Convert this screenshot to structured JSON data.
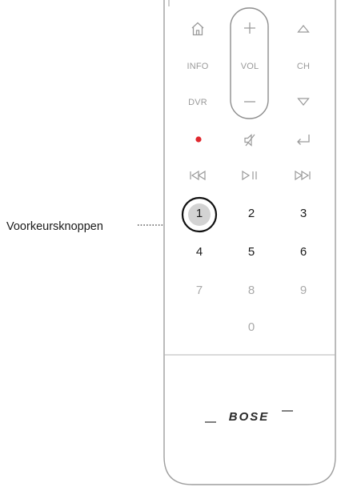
{
  "callout": {
    "label": "Voorkeursknoppen"
  },
  "remote": {
    "labels": {
      "info": "INFO",
      "dvr": "DVR",
      "vol": "VOL",
      "ch": "CH"
    },
    "presets": [
      "1",
      "2",
      "3",
      "4",
      "5",
      "6"
    ],
    "digits": [
      "7",
      "8",
      "9",
      "0"
    ],
    "brand": "BOSE",
    "highlighted_preset": "1",
    "record_color": "#e0282e",
    "icons": [
      "home-icon",
      "volume-up-icon",
      "channel-up-icon",
      "volume-down-icon",
      "channel-down-icon",
      "record-icon",
      "mute-icon",
      "return-icon",
      "skip-back-icon",
      "play-pause-icon",
      "skip-forward-icon"
    ]
  }
}
